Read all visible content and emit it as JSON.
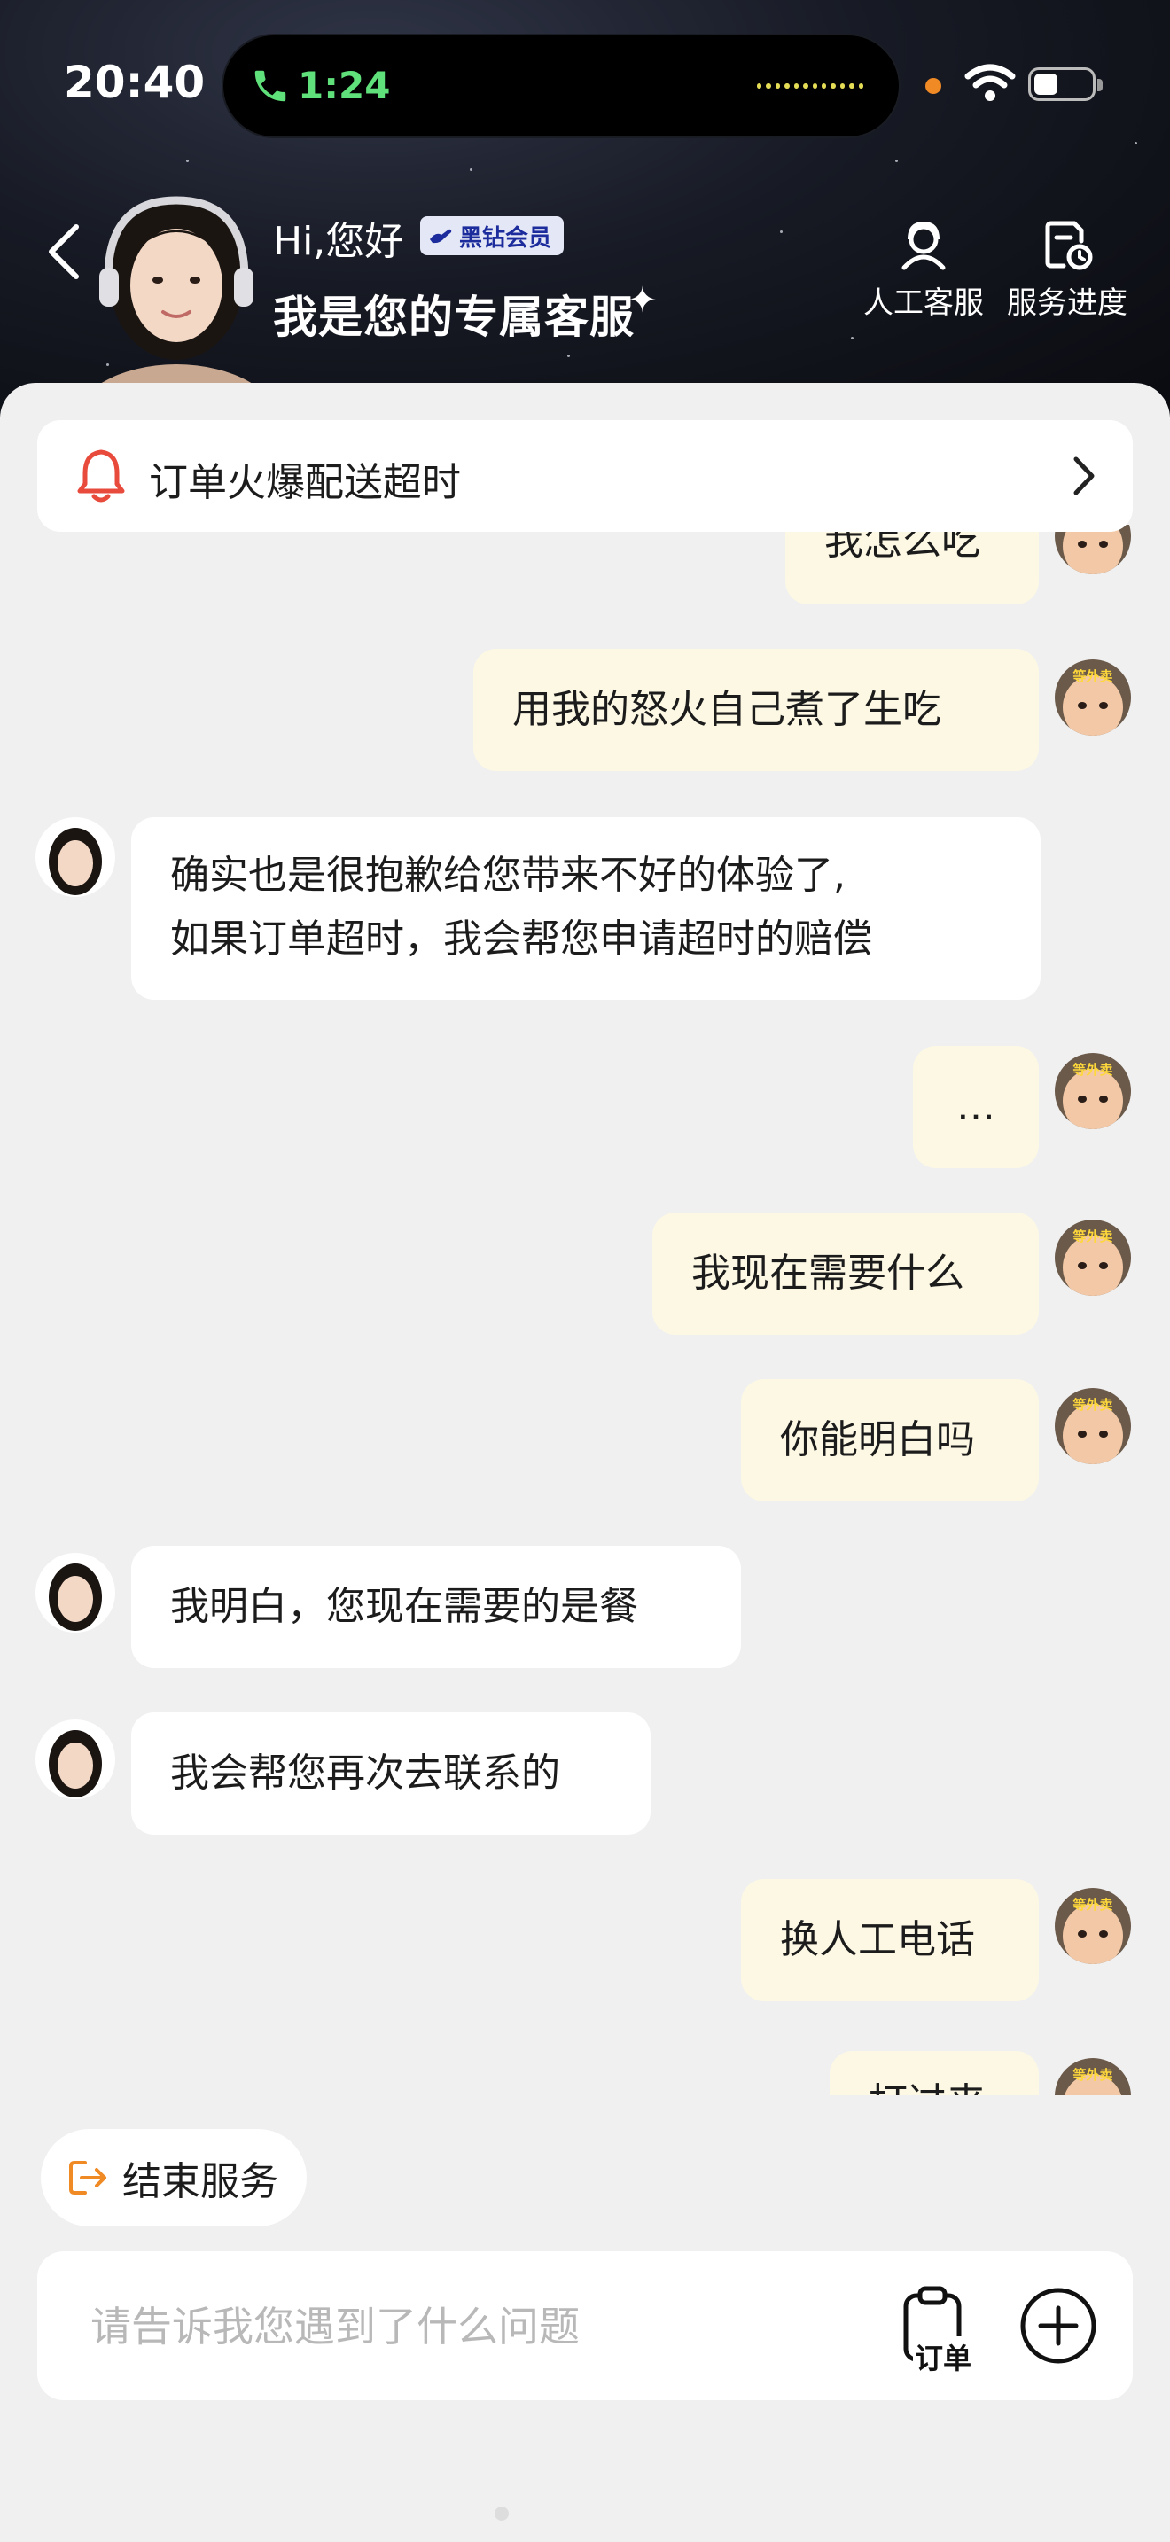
{
  "status_bar": {
    "time": "20:40",
    "call_duration": "1:24"
  },
  "header": {
    "greeting": "Hi,您好",
    "vip_badge": "黑钻会员",
    "title": "我是您的专属客服",
    "human_service_label": "人工客服",
    "service_progress_label": "服务进度"
  },
  "notice": {
    "text": "订单火爆配送超时"
  },
  "messages": [
    {
      "sender": "user",
      "text": "我怎么吃"
    },
    {
      "sender": "user",
      "text": "用我的怒火自己煮了生吃"
    },
    {
      "sender": "agent",
      "line1": "确实也是很抱歉给您带来不好的体验了,",
      "line2": "如果订单超时，我会帮您申请超时的赔偿"
    },
    {
      "sender": "user",
      "text": "…"
    },
    {
      "sender": "user",
      "text": "我现在需要什么"
    },
    {
      "sender": "user",
      "text": "你能明白吗"
    },
    {
      "sender": "agent",
      "text": "我明白，您现在需要的是餐"
    },
    {
      "sender": "agent",
      "text": "我会帮您再次去联系的"
    },
    {
      "sender": "user",
      "text": "换人工电话"
    },
    {
      "sender": "user",
      "text": "打过来"
    }
  ],
  "user_avatar_text": "等外卖",
  "end_service": {
    "label": "结束服务"
  },
  "input": {
    "placeholder": "请告诉我您遇到了什么问题",
    "value": ""
  },
  "order_button": {
    "label": "订单"
  },
  "colors": {
    "user_bubble": "#fcf8e4",
    "agent_bubble": "#ffffff",
    "page_bg": "#f0f0f0",
    "notice_icon": "#e84a3c",
    "end_service_icon": "#f08a24",
    "call_green": "#5fe07a",
    "vip_badge_text": "#1c2c9c"
  },
  "icons": [
    "back-chevron-icon",
    "headset-agent-icon",
    "progress-clock-icon",
    "bell-icon",
    "chevron-right-icon",
    "exit-icon",
    "clipboard-icon",
    "plus-circle-icon",
    "wifi-icon",
    "phone-icon"
  ]
}
